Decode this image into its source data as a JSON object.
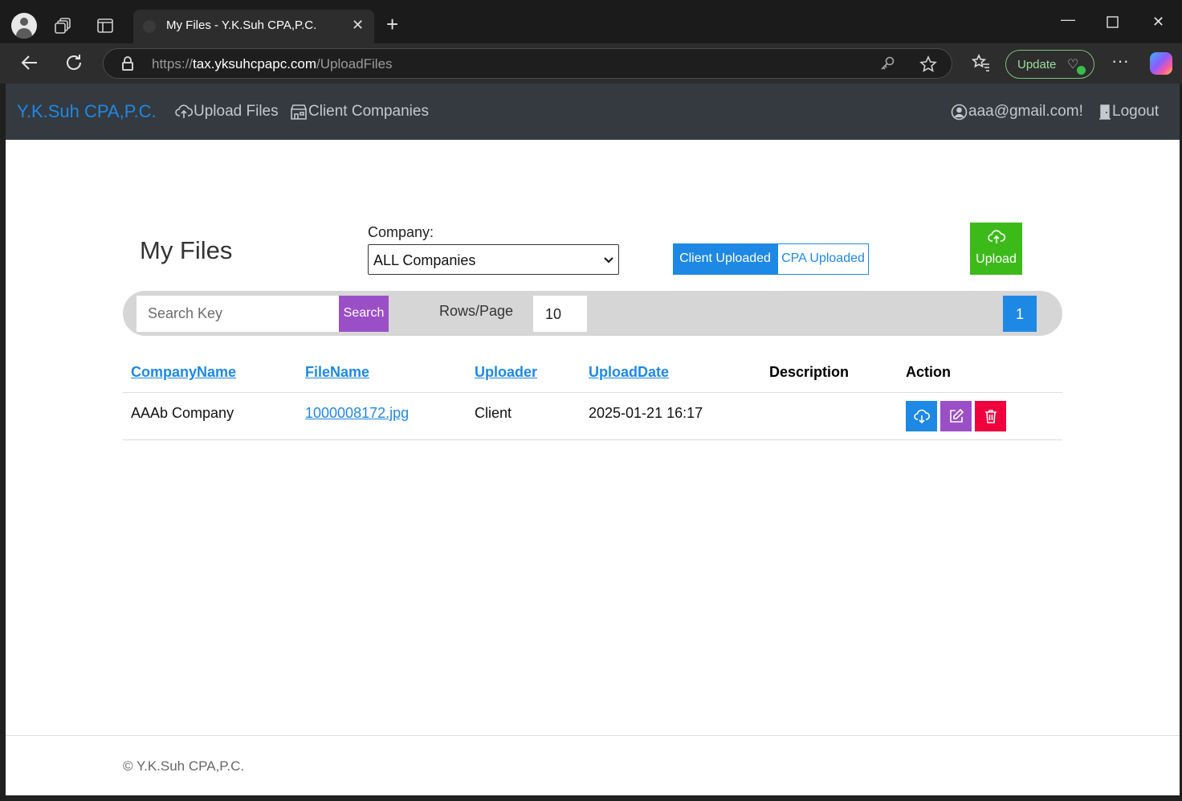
{
  "browser": {
    "tab_title": "My Files - Y.K.Suh CPA,P.C.",
    "url_scheme": "https://",
    "url_host": "tax.yksuhcpapc.com",
    "url_path": "/UploadFiles",
    "update_label": "Update"
  },
  "nav": {
    "brand": "Y.K.Suh CPA,P.C.",
    "upload_files": "Upload Files",
    "client_companies": "Client Companies",
    "user": "aaa@gmail.com!",
    "logout": "Logout",
    "brand_color": "#1e88e5",
    "bar_color": "#343a40"
  },
  "main": {
    "title": "My Files",
    "company_label": "Company:",
    "company_selected": "ALL Companies",
    "filter_client": "Client Uploaded",
    "filter_cpa": "CPA Uploaded",
    "upload_label": "Upload"
  },
  "toolbar": {
    "search_placeholder": "Search Key",
    "search_label": "Search",
    "rows_label": "Rows/Page",
    "rows_value": "10",
    "page": "1"
  },
  "table": {
    "headers": [
      "CompanyName",
      "FileName",
      "Uploader",
      "UploadDate",
      "Description",
      "Action"
    ],
    "rows": [
      {
        "company": "AAAb Company",
        "file": "1000008172.jpg",
        "uploader": "Client",
        "date": "2025-01-21 16:17",
        "description": ""
      }
    ],
    "action_icons": [
      "cloud-download-icon",
      "edit-icon",
      "trash-icon"
    ],
    "action_colors": [
      "#1e88e5",
      "#9b4fc7",
      "#f0003c"
    ]
  },
  "footer": {
    "copyright": "© Y.K.Suh CPA,P.C."
  }
}
